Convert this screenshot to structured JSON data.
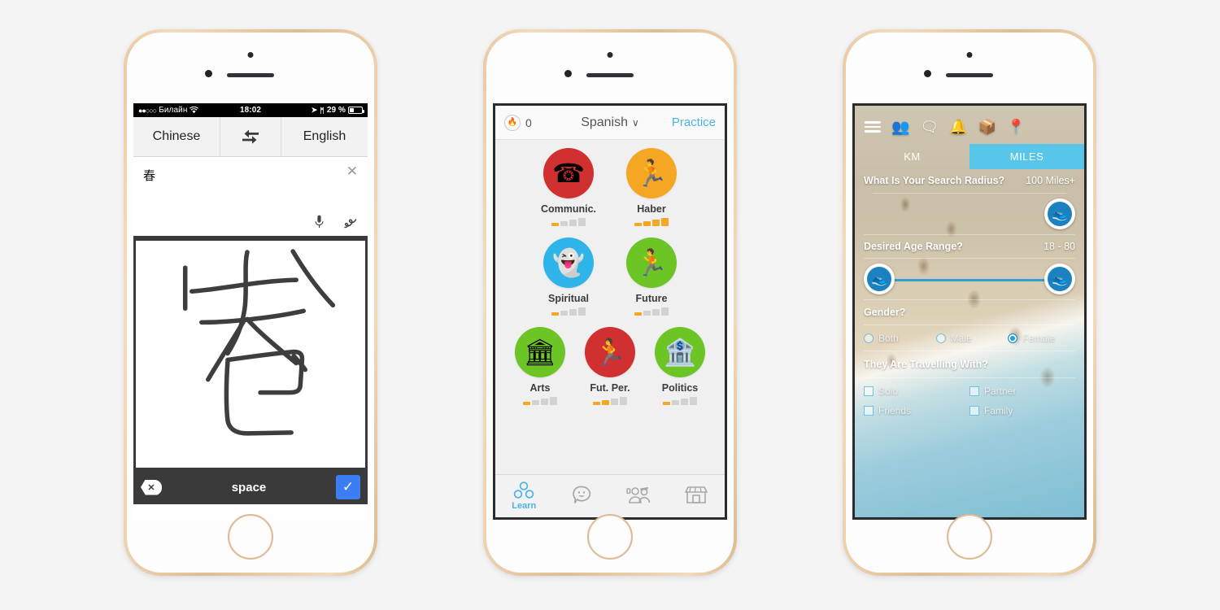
{
  "canvas": {
    "background": "#f4f4f4",
    "phone_frame_color": "#e3c098"
  },
  "phone1": {
    "name": "translate-app",
    "statusbar": {
      "signal_dots": "●●○○○",
      "carrier": "Билайн",
      "wifi_icon": "wifi",
      "time": "18:02",
      "location_icon": "➤",
      "bluetooth_icon": "ᛗ",
      "battery_percent": "29 %"
    },
    "language_bar": {
      "source": "Chinese",
      "swap_icon": "swap-arrows",
      "target": "English"
    },
    "input": {
      "value": "春",
      "clear_icon": "✕",
      "mic_icon": "microphone",
      "handwriting_icon": "handwriting-squiggle"
    },
    "handwriting_canvas": {
      "character": "春",
      "label": "handwriting-canvas"
    },
    "keyboard_bar": {
      "backspace_icon": "✕",
      "space_label": "space",
      "confirm_icon": "✓",
      "confirm_color": "#3b7df3"
    }
  },
  "phone2": {
    "name": "language-learning-app",
    "header": {
      "streak_icon": "flame-icon",
      "streak_count": "0",
      "language": "Spanish",
      "chevron": "∨",
      "practice_label": "Practice",
      "accent_color": "#4bb3e8"
    },
    "skills": [
      {
        "name": "Communic.",
        "icon": "☎",
        "color": "#d13030",
        "strength": 1
      },
      {
        "name": "Haber",
        "icon": "🏃",
        "color": "#f5a623",
        "strength": 4
      },
      {
        "name": "Spiritual",
        "icon": "👻",
        "color": "#2eb4e8",
        "strength": 1
      },
      {
        "name": "Future",
        "icon": "🏃",
        "color": "#6dc425",
        "strength": 1
      },
      {
        "name": "Arts",
        "icon": "🏛",
        "color": "#6dc425",
        "strength": 1
      },
      {
        "name": "Fut. Per.",
        "icon": "🏃",
        "color": "#d13030",
        "strength": 2
      },
      {
        "name": "Politics",
        "icon": "🏦",
        "color": "#6dc425",
        "strength": 1
      }
    ],
    "tabs": [
      {
        "label": "Learn",
        "icon": "three-circles-icon",
        "active": true
      },
      {
        "label": "",
        "icon": "speech-bubble-smiley-icon",
        "active": false
      },
      {
        "label": "",
        "icon": "friends-icon",
        "active": false
      },
      {
        "label": "",
        "icon": "shop-icon",
        "active": false
      }
    ]
  },
  "phone3": {
    "name": "travel-match-filters",
    "topbar": {
      "menu_icon": "hamburger-icon",
      "icons": [
        "people-icon",
        "chat-icon",
        "bell-icon",
        "box-icon",
        "location-pin-icon"
      ],
      "active_icon": "people-icon",
      "active_color": "#28a8e0"
    },
    "units": {
      "km_label": "KM",
      "miles_label": "MILES",
      "selected": "MILES",
      "selected_color": "#57c6ea"
    },
    "search_radius": {
      "label": "What Is Your Search Radius?",
      "value": "100 Miles+"
    },
    "age_range": {
      "label": "Desired Age Range?",
      "value": "18 - 80"
    },
    "gender": {
      "label": "Gender?",
      "options": [
        {
          "label": "Both",
          "selected": false
        },
        {
          "label": "Male",
          "selected": false
        },
        {
          "label": "Female",
          "selected": true
        }
      ]
    },
    "travelling_with": {
      "label": "They Are Travelling With?",
      "options": [
        {
          "label": "Solo",
          "checked": false
        },
        {
          "label": "Partner",
          "checked": false
        },
        {
          "label": "Friends",
          "checked": false
        },
        {
          "label": "Family",
          "checked": false
        }
      ]
    }
  }
}
